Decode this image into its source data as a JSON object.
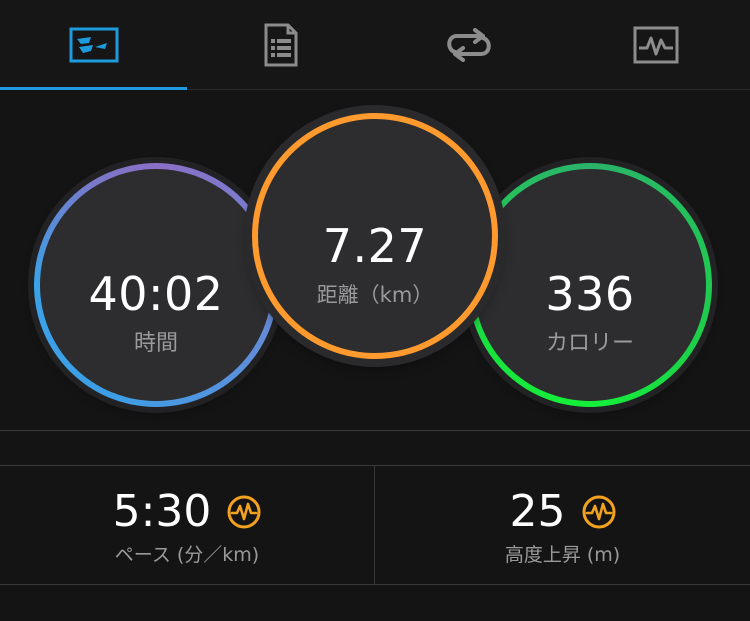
{
  "tabs": [
    {
      "icon": "summary-stats-icon",
      "active": true
    },
    {
      "icon": "document-list-icon",
      "active": false
    },
    {
      "icon": "laps-repeat-icon",
      "active": false
    },
    {
      "icon": "activity-chart-icon",
      "active": false
    }
  ],
  "rings": {
    "time": {
      "value": "40:02",
      "label": "時間"
    },
    "distance": {
      "value": "7.27",
      "label": "距離（km）"
    },
    "calories": {
      "value": "336",
      "label": "カロリー"
    }
  },
  "stats": {
    "pace": {
      "value": "5:30",
      "label": "ペース (分／km)",
      "icon": "performance-heart-icon"
    },
    "elevation": {
      "value": "25",
      "label": "高度上昇 (m)",
      "icon": "performance-heart-icon"
    }
  },
  "colors": {
    "accent": "#1e9bdc",
    "distance_ring": "#ff9a2e",
    "performance_icon": "#f3a21f",
    "time_ring_start": "#3aa2e8",
    "time_ring_end": "#8a6fc6",
    "calories_ring_start": "#2ab36a",
    "calories_ring_end": "#14f03a"
  }
}
